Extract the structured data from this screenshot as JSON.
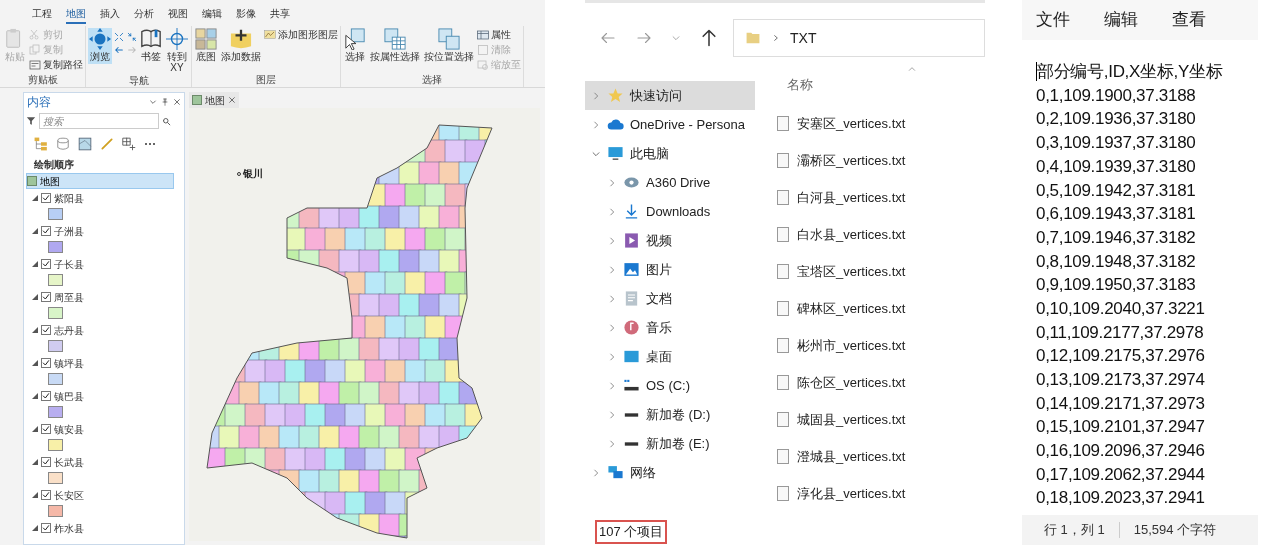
{
  "arcgis": {
    "ribbon_tabs": [
      {
        "label": "工程",
        "selected": false
      },
      {
        "label": "地图",
        "selected": true
      },
      {
        "label": "插入",
        "selected": false
      },
      {
        "label": "分析",
        "selected": false
      },
      {
        "label": "视图",
        "selected": false
      },
      {
        "label": "编辑",
        "selected": false
      },
      {
        "label": "影像",
        "selected": false
      },
      {
        "label": "共享",
        "selected": false
      }
    ],
    "ribbon_groups": [
      {
        "label": "剪贴板",
        "tools": [
          {
            "label": "粘贴",
            "kind": "paste",
            "disabled": true,
            "active": false
          },
          {
            "label": "剪切",
            "kind": "cut",
            "disabled": true,
            "active": false
          },
          {
            "label": "复制",
            "kind": "copy",
            "disabled": true,
            "active": false
          },
          {
            "label": "复制路径",
            "kind": "copypath",
            "disabled": false,
            "active": false
          }
        ]
      },
      {
        "label": "导航",
        "tools": [
          {
            "label": "浏览",
            "kind": "explore",
            "disabled": false,
            "active": true
          },
          {
            "label": "书签",
            "kind": "bookmark",
            "disabled": false,
            "active": false
          },
          {
            "label": "转到\nXY",
            "kind": "gotoxy",
            "disabled": false,
            "active": false
          }
        ]
      },
      {
        "label": "图层",
        "tools": [
          {
            "label": "底图",
            "kind": "basemap",
            "disabled": false,
            "active": false
          },
          {
            "label": "添加数据",
            "kind": "adddata",
            "disabled": false,
            "active": false
          },
          {
            "label": "添加图形图层",
            "kind": "graphics",
            "disabled": false,
            "active": false
          }
        ]
      },
      {
        "label": "选择",
        "tools": [
          {
            "label": "选择",
            "kind": "select",
            "disabled": false,
            "active": false
          },
          {
            "label": "按属性选择",
            "kind": "selattr",
            "disabled": false,
            "active": false
          },
          {
            "label": "按位置选择",
            "kind": "selloc",
            "disabled": false,
            "active": false
          },
          {
            "label": "属性",
            "kind": "attributes",
            "disabled": false,
            "active": false
          },
          {
            "label": "清除",
            "kind": "clear",
            "disabled": true,
            "active": false
          },
          {
            "label": "缩放至",
            "kind": "zoomto",
            "disabled": true,
            "active": false
          }
        ]
      }
    ],
    "contents": {
      "title": "内容",
      "search_placeholder": "搜索",
      "heading": "绘制顺序",
      "root": {
        "label": "地图",
        "selected": true,
        "children": [
          {
            "label": "紫阳县",
            "checked": true,
            "color": "#b8cff5"
          },
          {
            "label": "子洲县",
            "checked": true,
            "color": "#b0a8f0"
          },
          {
            "label": "子长县",
            "checked": true,
            "color": "#e6f5c8"
          },
          {
            "label": "周至县",
            "checked": true,
            "color": "#d8f5c8"
          },
          {
            "label": "志丹县",
            "checked": true,
            "color": "#d0ccf0"
          },
          {
            "label": "镇坪县",
            "checked": true,
            "color": "#c8daf5"
          },
          {
            "label": "镇巴县",
            "checked": true,
            "color": "#b8aef0"
          },
          {
            "label": "镇安县",
            "checked": true,
            "color": "#f8f0a8"
          },
          {
            "label": "长武县",
            "checked": true,
            "color": "#fae0c8"
          },
          {
            "label": "长安区",
            "checked": true,
            "color": "#f5b8a8"
          },
          {
            "label": "柞水县",
            "checked": true
          }
        ]
      }
    },
    "map_view": {
      "tab": "地图",
      "city_label": "银川"
    }
  },
  "explorer": {
    "path": "TXT",
    "sidebar": [
      {
        "label": "快速访问",
        "kind": "star",
        "selected": true,
        "expanded": false
      },
      {
        "label": "OneDrive - Persona",
        "kind": "cloud",
        "selected": false,
        "expanded": false
      },
      {
        "label": "此电脑",
        "kind": "pc",
        "selected": false,
        "expanded": true,
        "children": [
          {
            "label": "A360 Drive",
            "kind": "a360"
          },
          {
            "label": "Downloads",
            "kind": "download"
          },
          {
            "label": "视频",
            "kind": "video"
          },
          {
            "label": "图片",
            "kind": "picture"
          },
          {
            "label": "文档",
            "kind": "document"
          },
          {
            "label": "音乐",
            "kind": "music"
          },
          {
            "label": "桌面",
            "kind": "desktop"
          },
          {
            "label": "OS (C:)",
            "kind": "osdrive"
          },
          {
            "label": "新加卷 (D:)",
            "kind": "drive"
          },
          {
            "label": "新加卷 (E:)",
            "kind": "drive"
          }
        ]
      },
      {
        "label": "网络",
        "kind": "network",
        "selected": false,
        "expanded": false
      }
    ],
    "column": "名称",
    "files": [
      "安塞区_vertices.txt",
      "灞桥区_vertices.txt",
      "白河县_vertices.txt",
      "白水县_vertices.txt",
      "宝塔区_vertices.txt",
      "碑林区_vertices.txt",
      "彬州市_vertices.txt",
      "陈仓区_vertices.txt",
      "城固县_vertices.txt",
      "澄城县_vertices.txt",
      "淳化县_vertices.txt"
    ],
    "item_count": "107 个项目"
  },
  "notepad": {
    "menu": [
      "文件",
      "编辑",
      "查看"
    ],
    "lines": [
      "部分编号,ID,X坐标,Y坐标",
      "0,1,109.1900,37.3188",
      "0,2,109.1936,37.3180",
      "0,3,109.1937,37.3180",
      "0,4,109.1939,37.3180",
      "0,5,109.1942,37.3181",
      "0,6,109.1943,37.3181",
      "0,7,109.1946,37.3182",
      "0,8,109.1948,37.3182",
      "0,9,109.1950,37.3183",
      "0,10,109.2040,37.3221",
      "0,11,109.2177,37.2978",
      "0,12,109.2175,37.2976",
      "0,13,109.2173,37.2974",
      "0,14,109.2171,37.2973",
      "0,15,109.2101,37.2947",
      "0,16,109.2096,37.2946",
      "0,17,109.2062,37.2944",
      "0,18,109.2023,37.2941"
    ],
    "status": [
      "行 1，列 1",
      "15,594 个字符"
    ]
  }
}
